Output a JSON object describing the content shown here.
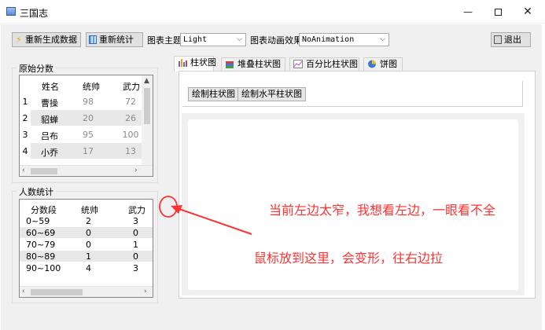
{
  "window": {
    "title": "三国志",
    "minimize_glyph": "—",
    "close_glyph": "✕"
  },
  "toolbar": {
    "regenerate_label": "重新生成数据",
    "recount_label": "重新统计",
    "theme_label": "图表主题",
    "theme_value": "Light",
    "animation_label": "图表动画效果",
    "animation_value": "NoAnimation",
    "exit_label": "退出"
  },
  "raw_scores": {
    "title": "原始分数",
    "columns": [
      "姓名",
      "统帅",
      "武力"
    ],
    "rows": [
      {
        "index": "1",
        "name": "曹操",
        "command": "98",
        "force": "72"
      },
      {
        "index": "2",
        "name": "貂蝉",
        "command": "20",
        "force": "26"
      },
      {
        "index": "3",
        "name": "吕布",
        "command": "95",
        "force": "100"
      },
      {
        "index": "4",
        "name": "小乔",
        "command": "17",
        "force": "13"
      }
    ]
  },
  "headcount": {
    "title": "人数统计",
    "columns": [
      "分数段",
      "统帅",
      "武力"
    ],
    "rows": [
      {
        "range": "0~59",
        "command": "2",
        "force": "3"
      },
      {
        "range": "60~69",
        "command": "0",
        "force": "0"
      },
      {
        "range": "70~79",
        "command": "0",
        "force": "1"
      },
      {
        "range": "80~89",
        "command": "1",
        "force": "0"
      },
      {
        "range": "90~100",
        "command": "4",
        "force": "3"
      }
    ]
  },
  "tabs": [
    {
      "label": "柱状图",
      "icon": "bar-chart-icon"
    },
    {
      "label": "堆叠柱状图",
      "icon": "stacked-bar-icon"
    },
    {
      "label": "百分比柱状图",
      "icon": "percent-bar-icon"
    },
    {
      "label": "饼图",
      "icon": "pie-chart-icon"
    }
  ],
  "bar_tab": {
    "draw_bar_label": "绘制柱状图",
    "draw_hbar_label": "绘制水平柱状图"
  },
  "annotations": {
    "line1": "当前左边太窄，我想看左边，一眼看不全",
    "line2": "鼠标放到这里，会变形，往右边拉",
    "color": "#ff3333"
  }
}
